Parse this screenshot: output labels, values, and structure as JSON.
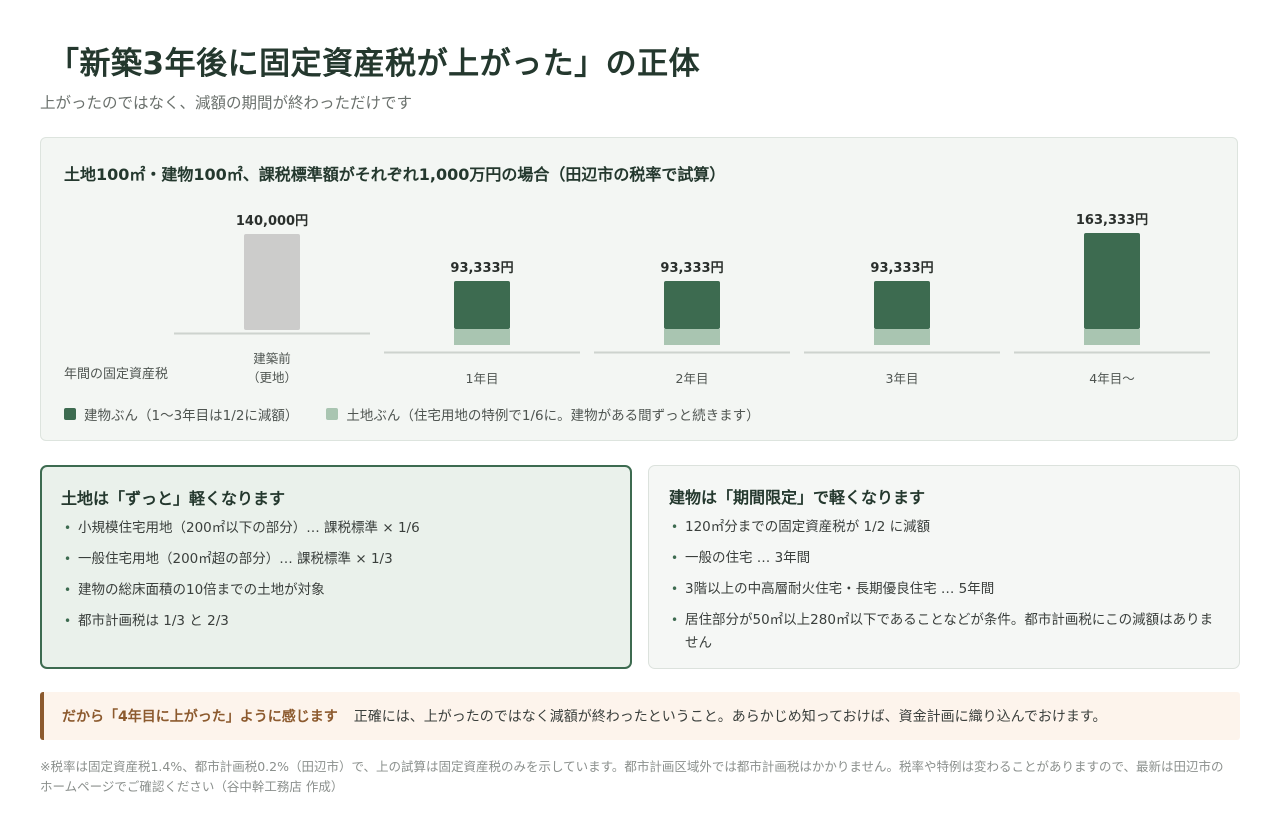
{
  "header": {
    "title": "「新築3年後に固定資産税が上がった」の正体",
    "subtitle": "上がったのではなく、減額の期間が終わっただけです"
  },
  "chart_section": {
    "heading": "土地100㎡・建物100㎡、課税標準額がそれぞれ1,000万円の場合（田辺市の税率で試算）",
    "y_label": "年間の固定資産税",
    "legend": [
      {
        "label": "建物ぶん（1〜3年目は1/2に減額）",
        "color": "#3d6b50"
      },
      {
        "label": "土地ぶん（住宅用地の特例で1/6に。建物がある間ずっと続きます）",
        "color": "#a9c5b1"
      }
    ]
  },
  "chart_data": {
    "type": "bar",
    "stacked": true,
    "ylabel": "年間の固定資産税",
    "categories": [
      "建築前\n（更地）",
      "1年目",
      "2年目",
      "3年目",
      "4年目〜"
    ],
    "series": [
      {
        "name": "建物ぶん（1〜3年目は1/2に減額）",
        "color": "#3d6b50",
        "values": [
          0,
          70000,
          70000,
          70000,
          140000
        ]
      },
      {
        "name": "土地ぶん（住宅用地の特例で1/6に。建物がある間ずっと続きます）",
        "color": "#a9c5b1",
        "values": [
          0,
          23333,
          23333,
          23333,
          23333
        ]
      }
    ],
    "vacant_land_value": 140000,
    "vacant_land_color": "#cccccb",
    "totals": [
      140000,
      93333,
      93333,
      93333,
      163333
    ],
    "total_labels": [
      "140,000円",
      "93,333円",
      "93,333円",
      "93,333円",
      "163,333円"
    ],
    "grid": false
  },
  "land_card": {
    "title": "土地は「ずっと」軽くなります",
    "items": [
      "小規模住宅用地（200㎡以下の部分）… 課税標準 × 1/6",
      "一般住宅用地（200㎡超の部分）… 課税標準 × 1/3",
      "建物の総床面積の10倍までの土地が対象",
      "都市計画税は 1/3 と 2/3"
    ]
  },
  "building_card": {
    "title": "建物は「期間限定」で軽くなります",
    "items": [
      "120㎡分までの固定資産税が 1/2 に減額",
      "一般の住宅 … 3年間",
      "3階以上の中高層耐火住宅・長期優良住宅 … 5年間",
      "居住部分が50㎡以上280㎡以下であることなどが条件。都市計画税にこの減額はありません"
    ]
  },
  "callout": {
    "lead": "だから「4年目に上がった」ように感じます",
    "body": "正確には、上がったのではなく減額が終わったということ。あらかじめ知っておけば、資金計画に織り込んでおけます。"
  },
  "footnote": "※税率は固定資産税1.4%、都市計画税0.2%（田辺市）で、上の試算は固定資産税のみを示しています。都市計画区域外では都市計画税はかかりません。税率や特例は変わることがありますので、最新は田辺市のホームページでご確認ください（谷中幹工務店 作成）"
}
